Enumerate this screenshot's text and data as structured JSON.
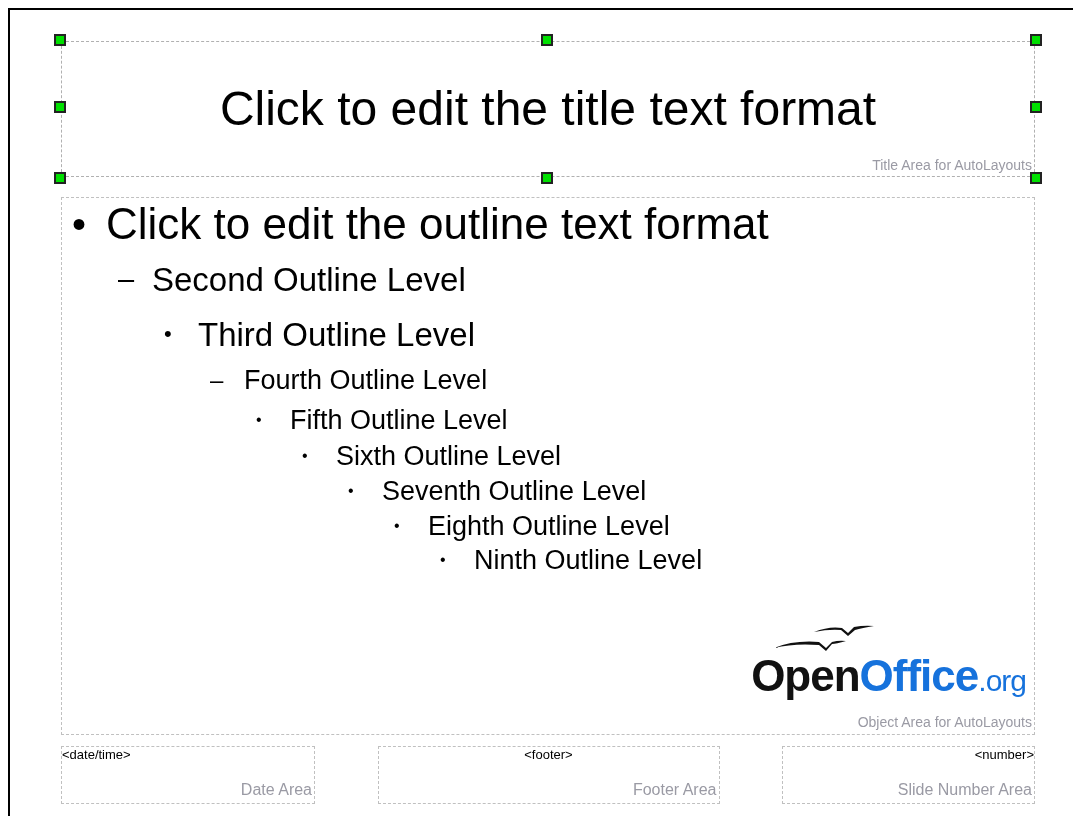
{
  "title_area": {
    "text": "Click to edit the title text format",
    "label": "Title Area for AutoLayouts",
    "selected": true
  },
  "object_area": {
    "label": "Object Area for AutoLayouts",
    "outline": [
      {
        "bullet": "•",
        "text": "Click to edit the outline text format",
        "children": [
          {
            "bullet": "–",
            "text": "Second Outline Level",
            "children": [
              {
                "bullet": "•",
                "text": "Third Outline Level",
                "children": [
                  {
                    "bullet": "–",
                    "text": "Fourth Outline Level",
                    "children": [
                      {
                        "bullet": "•",
                        "text": "Fifth Outline Level",
                        "children": [
                          {
                            "bullet": "•",
                            "text": "Sixth Outline Level",
                            "children": [
                              {
                                "bullet": "•",
                                "text": "Seventh Outline Level",
                                "children": [
                                  {
                                    "bullet": "•",
                                    "text": "Eighth Outline Level",
                                    "children": [
                                      {
                                        "bullet": "•",
                                        "text": "Ninth Outline Level"
                                      }
                                    ]
                                  }
                                ]
                              }
                            ]
                          }
                        ]
                      }
                    ]
                  }
                ]
              }
            ]
          }
        ]
      }
    ],
    "logo": {
      "dark": "Open",
      "blue": "Office",
      "suffix": ".org"
    }
  },
  "footer_areas": [
    {
      "field": "<date/time>",
      "label": "Date Area"
    },
    {
      "field": "<footer>",
      "label": "Footer Area"
    },
    {
      "field": "<number>",
      "label": "Slide Number Area"
    }
  ]
}
